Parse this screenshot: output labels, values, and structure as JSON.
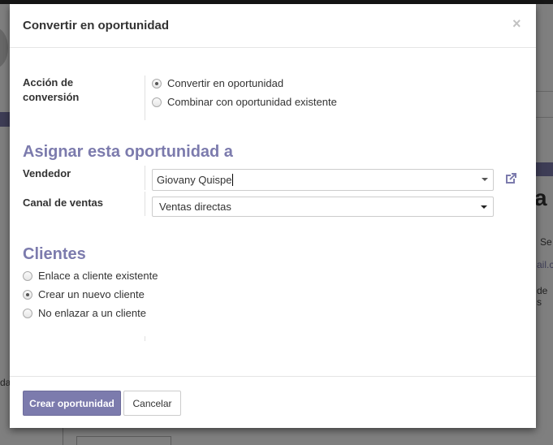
{
  "background": {
    "text_fragments": [
      "a",
      "Se",
      "ail.c",
      "de s",
      "da"
    ]
  },
  "dialog": {
    "title": "Convertir en oportunidad",
    "close_glyph": "×"
  },
  "conversion": {
    "label_line1": "Acción de",
    "label_line2": "conversión",
    "options": [
      {
        "label": "Convertir en oportunidad",
        "checked": true
      },
      {
        "label": "Combinar con oportunidad existente",
        "checked": false
      }
    ]
  },
  "assign": {
    "section_title": "Asignar esta oportunidad a",
    "salesperson_label": "Vendedor",
    "salesperson_value": "Giovany Quispe",
    "sales_channel_label": "Canal de ventas",
    "sales_channel_value": "Ventas directas",
    "external_link_icon": "external-link-icon"
  },
  "clients": {
    "section_title": "Clientes",
    "options": [
      {
        "label": "Enlace a cliente existente",
        "checked": false
      },
      {
        "label": "Crear un nuevo cliente",
        "checked": true
      },
      {
        "label": "No enlazar a un cliente",
        "checked": false
      }
    ]
  },
  "footer": {
    "primary_label": "Crear oportunidad",
    "cancel_label": "Cancelar"
  },
  "colors": {
    "accent": "#7c7bad",
    "overlay": "rgba(0,0,0,0.5)"
  }
}
